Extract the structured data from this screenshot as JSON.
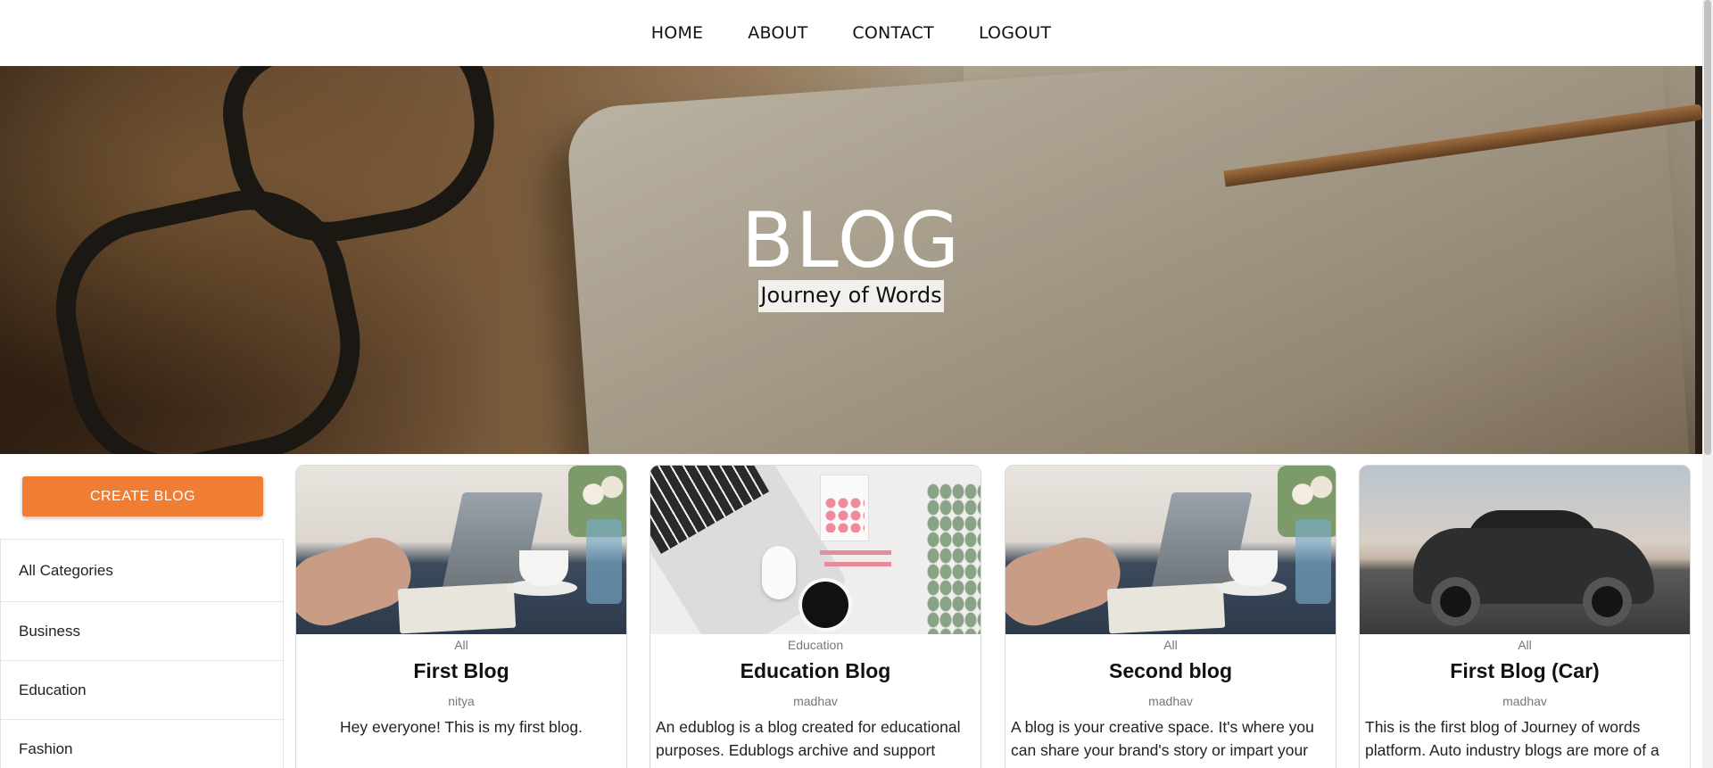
{
  "nav": {
    "items": [
      {
        "label": "HOME"
      },
      {
        "label": "ABOUT"
      },
      {
        "label": "CONTACT"
      },
      {
        "label": "LOGOUT"
      }
    ]
  },
  "hero": {
    "title": "BLOG",
    "subtitle": "Journey of Words",
    "image_icon": "desk-glasses-notebook-image"
  },
  "sidebar": {
    "create_label": "CREATE BLOG",
    "create_color": "#ef7d33",
    "categories": [
      {
        "label": "All Categories"
      },
      {
        "label": "Business"
      },
      {
        "label": "Education"
      },
      {
        "label": "Fashion"
      }
    ]
  },
  "posts": [
    {
      "category": "All",
      "title": "First Blog",
      "author": "nitya",
      "description": "Hey everyone! This is my first blog.",
      "image_icon": "laptop-desk-image"
    },
    {
      "category": "Education",
      "title": "Education Blog",
      "author": "madhav",
      "description": "An edublog is a blog created for educational purposes. Edublogs archive and support",
      "image_icon": "workspace-flatlay-image"
    },
    {
      "category": "All",
      "title": "Second blog",
      "author": "madhav",
      "description": "A blog is your creative space. It's where you can share your brand's story or impart your",
      "image_icon": "laptop-desk-image"
    },
    {
      "category": "All",
      "title": "First Blog (Car)",
      "author": "madhav",
      "description": "This is the first blog of Journey of words platform. Auto industry blogs are more of a",
      "image_icon": "car-image"
    }
  ]
}
